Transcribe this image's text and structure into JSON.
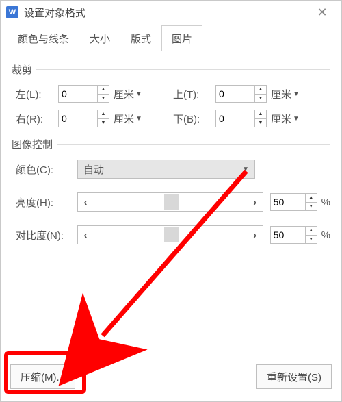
{
  "titlebar": {
    "title": "设置对象格式",
    "close_tooltip": "关闭"
  },
  "tabs": {
    "color_line": "颜色与线条",
    "size": "大小",
    "layout": "版式",
    "picture": "图片"
  },
  "crop": {
    "legend": "裁剪",
    "left_label": "左(L):",
    "left_value": "0",
    "left_unit": "厘米",
    "right_label": "右(R):",
    "right_value": "0",
    "right_unit": "厘米",
    "top_label": "上(T):",
    "top_value": "0",
    "top_unit": "厘米",
    "bottom_label": "下(B):",
    "bottom_value": "0",
    "bottom_unit": "厘米"
  },
  "image_ctrl": {
    "legend": "图像控制",
    "color_label": "颜色(C):",
    "color_value": "自动",
    "brightness_label": "亮度(H):",
    "brightness_value": "50",
    "brightness_unit": "%",
    "contrast_label": "对比度(N):",
    "contrast_value": "50",
    "contrast_unit": "%"
  },
  "footer": {
    "compress": "压缩(M)...",
    "reset": "重新设置(S)"
  },
  "glyphs": {
    "up": "▲",
    "down": "▼",
    "caret": "▼",
    "left": "‹",
    "right": "›",
    "close": "✕",
    "app_letter": "W"
  }
}
